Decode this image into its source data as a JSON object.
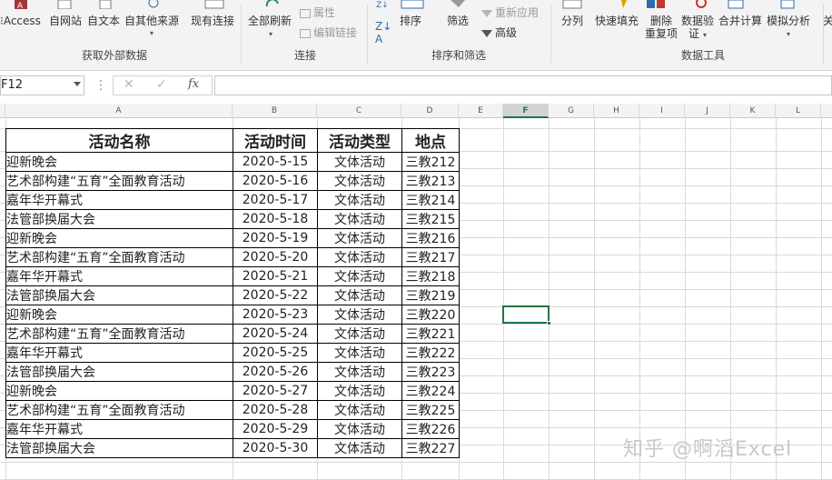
{
  "ribbon": {
    "ext_data": {
      "btn_access": "Access",
      "btn_web": "自网站",
      "btn_text": "自文本",
      "btn_other": "自其他来源",
      "btn_existing": "现有连接",
      "group": "获取外部数据"
    },
    "connections": {
      "btn_refresh": "全部刷新",
      "btn_props": "属性",
      "btn_editlinks": "编辑链接",
      "group": "连接"
    },
    "sort_filter": {
      "btn_sort": "排序",
      "btn_filter": "筛选",
      "btn_reapply": "重新应用",
      "btn_advanced": "高级",
      "group": "排序和筛选"
    },
    "data_tools": {
      "btn_split": "分列",
      "btn_flashfill": "快速填充",
      "btn_dedupe_1": "删除",
      "btn_dedupe_2": "重复项",
      "btn_validate_1": "数据验",
      "btn_validate_2": "证",
      "btn_consolidate": "合并计算",
      "btn_whatif": "模拟分析",
      "btn_relations": "关",
      "group": "数据工具"
    }
  },
  "formula_bar": {
    "name_box": "F12",
    "fx": "fx",
    "cancel": "✕",
    "enter": "✓",
    "dots": "⋮",
    "formula": ""
  },
  "columns": [
    "A",
    "B",
    "C",
    "D",
    "E",
    "F",
    "G",
    "H",
    "I",
    "J",
    "K",
    "L"
  ],
  "selected_column": "F",
  "table": {
    "headers": [
      "活动名称",
      "活动时间",
      "活动类型",
      "地点"
    ],
    "rows": [
      [
        "迎新晚会",
        "2020-5-15",
        "文体活动",
        "三教212"
      ],
      [
        "艺术部构建“五育”全面教育活动",
        "2020-5-16",
        "文体活动",
        "三教213"
      ],
      [
        "嘉年华开幕式",
        "2020-5-17",
        "文体活动",
        "三教214"
      ],
      [
        "法管部换届大会",
        "2020-5-18",
        "文体活动",
        "三教215"
      ],
      [
        "迎新晚会",
        "2020-5-19",
        "文体活动",
        "三教216"
      ],
      [
        "艺术部构建“五育”全面教育活动",
        "2020-5-20",
        "文体活动",
        "三教217"
      ],
      [
        "嘉年华开幕式",
        "2020-5-21",
        "文体活动",
        "三教218"
      ],
      [
        "法管部换届大会",
        "2020-5-22",
        "文体活动",
        "三教219"
      ],
      [
        "迎新晚会",
        "2020-5-23",
        "文体活动",
        "三教220"
      ],
      [
        "艺术部构建“五育”全面教育活动",
        "2020-5-24",
        "文体活动",
        "三教221"
      ],
      [
        "嘉年华开幕式",
        "2020-5-25",
        "文体活动",
        "三教222"
      ],
      [
        "法管部换届大会",
        "2020-5-26",
        "文体活动",
        "三教223"
      ],
      [
        "迎新晚会",
        "2020-5-27",
        "文体活动",
        "三教224"
      ],
      [
        "艺术部构建“五育”全面教育活动",
        "2020-5-28",
        "文体活动",
        "三教225"
      ],
      [
        "嘉年华开幕式",
        "2020-5-29",
        "文体活动",
        "三教226"
      ],
      [
        "法管部换届大会",
        "2020-5-30",
        "文体活动",
        "三教227"
      ]
    ]
  },
  "watermark": "知乎 @啊滔Excel",
  "colors": {
    "accent": "#217346",
    "ribbon_bg": "#f3f3f3",
    "grid_line": "#d9d9d9"
  }
}
